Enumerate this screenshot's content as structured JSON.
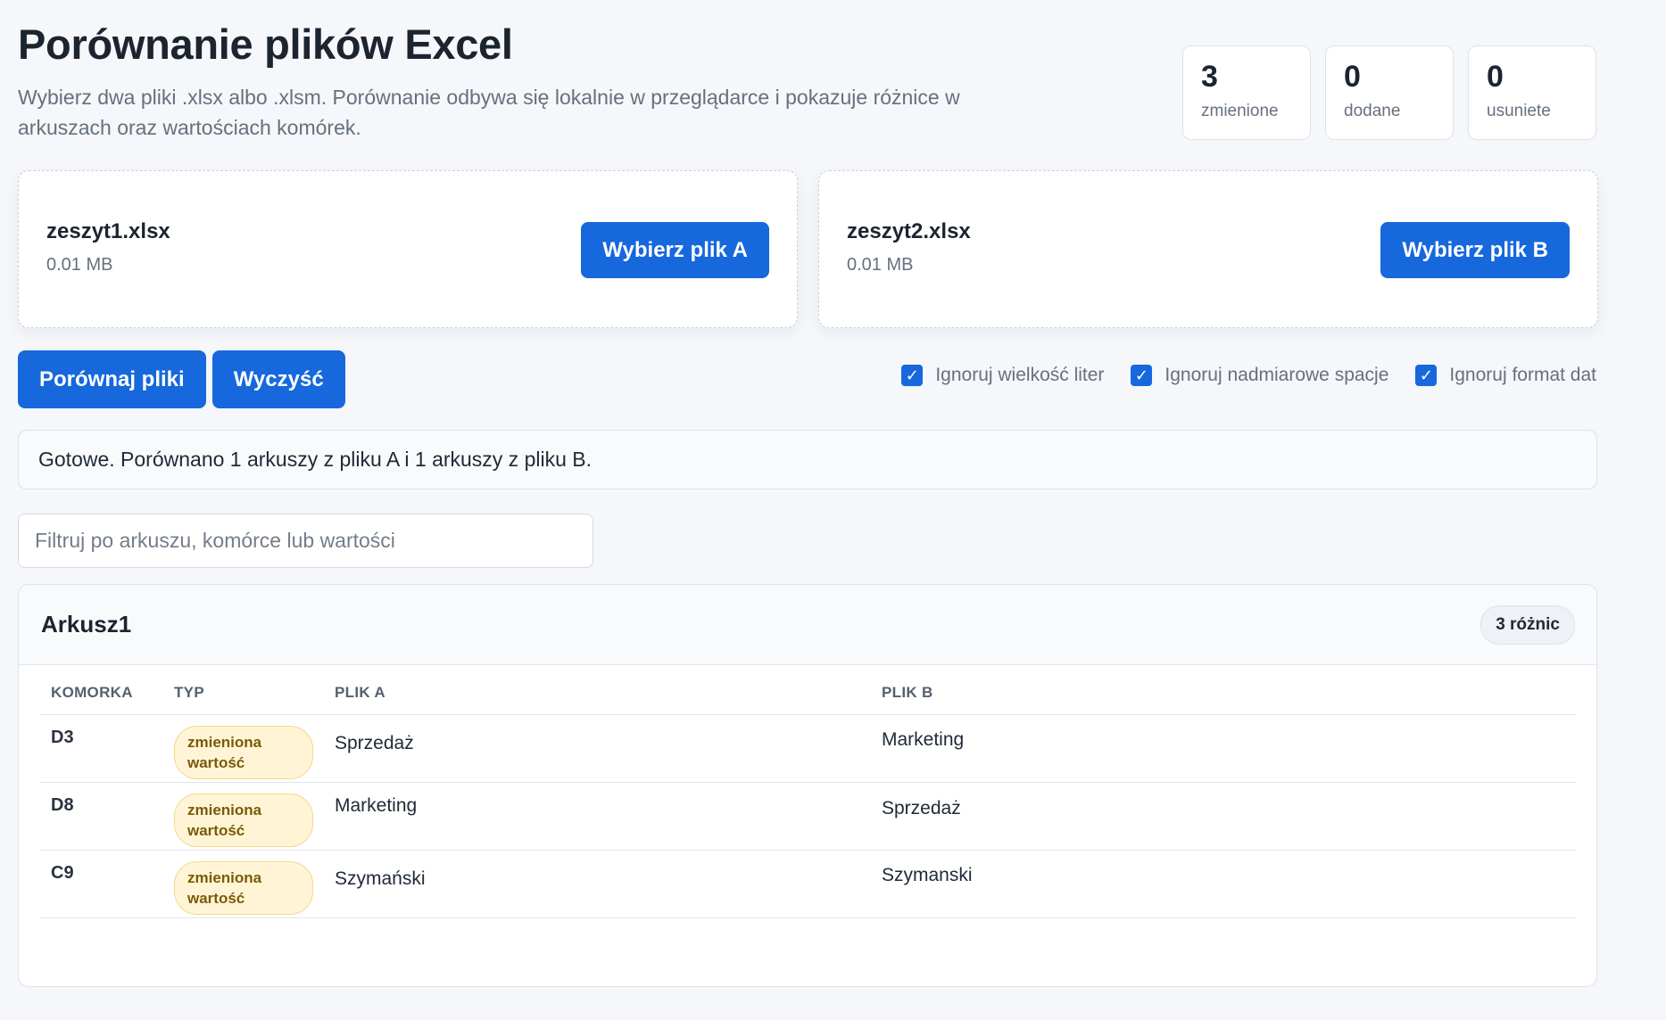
{
  "header": {
    "title": "Porównanie plików Excel",
    "subtitle": "Wybierz dwa pliki .xlsx albo .xlsm. Porównanie odbywa się lokalnie w przeglądarce i pokazuje różnice w arkuszach oraz wartościach komórek."
  },
  "stats": {
    "changed": {
      "value": "3",
      "label": "zmienione"
    },
    "added": {
      "value": "0",
      "label": "dodane"
    },
    "removed": {
      "value": "0",
      "label": "usuniete"
    }
  },
  "files": {
    "a": {
      "name": "zeszyt1.xlsx",
      "size": "0.01 MB",
      "button": "Wybierz plik A"
    },
    "b": {
      "name": "zeszyt2.xlsx",
      "size": "0.01 MB",
      "button": "Wybierz plik B"
    }
  },
  "actions": {
    "compare": "Porównaj pliki",
    "clear": "Wyczyść"
  },
  "options": {
    "ignore_case": {
      "label": "Ignoruj wielkość liter",
      "checked": true
    },
    "ignore_spaces": {
      "label": "Ignoruj nadmiarowe spacje",
      "checked": true
    },
    "ignore_dates": {
      "label": "Ignoruj format dat",
      "checked": true
    }
  },
  "status": "Gotowe. Porównano 1 arkuszy z pliku A i 1 arkuszy z pliku B.",
  "filter": {
    "placeholder": "Filtruj po arkuszu, komórce lub wartości",
    "value": ""
  },
  "sheet": {
    "name": "Arkusz1",
    "diff_count": "3 różnic",
    "columns": [
      "KOMORKA",
      "TYP",
      "PLIK A",
      "PLIK B"
    ],
    "rows": [
      {
        "cell": "D3",
        "type": "zmieniona wartość",
        "a": "Sprzedaż",
        "b": "Marketing"
      },
      {
        "cell": "D8",
        "type": "zmieniona wartość",
        "a": "Marketing",
        "b": "Sprzedaż"
      },
      {
        "cell": "C9",
        "type": "zmieniona wartość",
        "a": "Szymański",
        "b": "Szymanski"
      }
    ]
  },
  "colors": {
    "accent": "#1668dc",
    "badge_bg": "#fff5d6",
    "badge_text": "#7a5a06"
  },
  "icons": {
    "checkbox": "checkmark-icon"
  }
}
